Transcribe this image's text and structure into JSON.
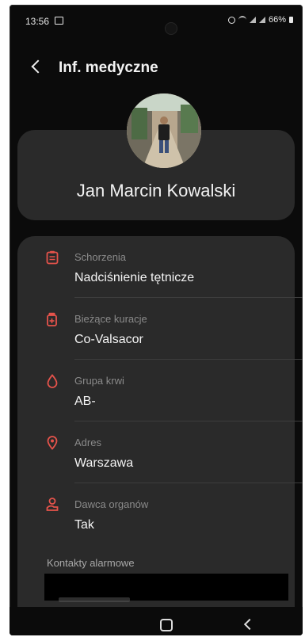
{
  "status_bar": {
    "time": "13:56",
    "battery": "66%",
    "icons": [
      "notification-icon",
      "alarm-icon",
      "wifi-icon",
      "signal-icon",
      "battery-icon"
    ]
  },
  "header": {
    "title": "Inf. medyczne",
    "back_icon": "back-arrow-icon"
  },
  "profile": {
    "name": "Jan Marcin Kowalski"
  },
  "medical_info": {
    "accent_color": "#e5534b",
    "items": [
      {
        "label": "Schorzenia",
        "value": "Nadciśnienie tętnicze",
        "icon": "clipboard-icon"
      },
      {
        "label": "Bieżące kuracje",
        "value": "Co-Valsacor",
        "icon": "medication-icon"
      },
      {
        "label": "Grupa krwi",
        "value": "AB-",
        "icon": "blood-drop-icon"
      },
      {
        "label": "Adres",
        "value": "Warszawa",
        "icon": "location-pin-icon"
      },
      {
        "label": "Dawca organów",
        "value": "Tak",
        "icon": "organ-donor-icon"
      }
    ]
  },
  "emergency_contacts": {
    "label": "Kontakty alarmowe"
  },
  "nav_bar": {
    "icons": [
      "home-icon",
      "back-icon"
    ]
  }
}
